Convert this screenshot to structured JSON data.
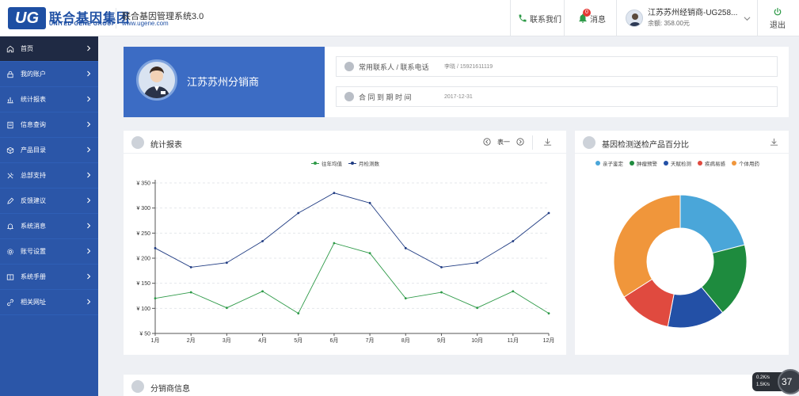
{
  "header": {
    "logo_mark": "UG",
    "logo_cn": "联合基因集团",
    "logo_en": "UNITED GENE GROUP",
    "system_title": "联合基因管理系统3.0",
    "system_url": "www.ugene.com",
    "contact_label": "联系我们",
    "messages_label": "消息",
    "messages_count": "0",
    "user_name": "江苏苏州经销商-UG258...",
    "user_balance": "余额: 358.00元",
    "logout_label": "退出",
    "accent_color": "#1e4fa3"
  },
  "sidebar": {
    "items": [
      {
        "label": "首页",
        "icon": "home-icon",
        "active": true
      },
      {
        "label": "我的账户",
        "icon": "lock-icon"
      },
      {
        "label": "统计报表",
        "icon": "bar-chart-icon"
      },
      {
        "label": "信息查询",
        "icon": "document-icon"
      },
      {
        "label": "产品目录",
        "icon": "box-icon"
      },
      {
        "label": "总部支持",
        "icon": "tools-icon"
      },
      {
        "label": "反馈建议",
        "icon": "edit-icon"
      },
      {
        "label": "系统消息",
        "icon": "bell-icon"
      },
      {
        "label": "账号设置",
        "icon": "gear-icon"
      },
      {
        "label": "系统手册",
        "icon": "book-icon"
      },
      {
        "label": "相关网址",
        "icon": "link-icon"
      }
    ],
    "bg_color": "#2b56a8"
  },
  "profile": {
    "name": "江苏苏州分销商",
    "contact_label": "常用联系人 / 联系电话",
    "contact_value": "李晓 / 15921611119",
    "contract_label": "合 同 到 期 时 间",
    "contract_value": "2017-12-31"
  },
  "stats_panel": {
    "title": "统计报表",
    "series_switch": "表一"
  },
  "pie_panel": {
    "title": "基因检测送检产品百分比"
  },
  "distributor_panel": {
    "title": "分销商信息"
  },
  "widget": {
    "line1": "0.2K/s",
    "line2": "1.5K/s",
    "percent": "37"
  },
  "chart_data": [
    {
      "type": "line",
      "x": [
        "1月",
        "2月",
        "3月",
        "4月",
        "5月",
        "6月",
        "7月",
        "8月",
        "9月",
        "10月",
        "11月",
        "12月"
      ],
      "series": [
        {
          "name": "往年均值",
          "color": "#2e9a48",
          "values": [
            120,
            132,
            101,
            134,
            90,
            230,
            210,
            120,
            132,
            101,
            134,
            90
          ]
        },
        {
          "name": "月检测数",
          "color": "#1f3b82",
          "values": [
            220,
            182,
            191,
            234,
            290,
            330,
            310,
            220,
            182,
            191,
            234,
            290
          ]
        }
      ],
      "y_ticks": [
        "¥ 50",
        "¥ 100",
        "¥ 150",
        "¥ 200",
        "¥ 250",
        "¥ 300",
        "¥ 350"
      ],
      "ylim": [
        50,
        350
      ],
      "grid": true,
      "legend": "top-center"
    },
    {
      "type": "pie",
      "donut": true,
      "labels": [
        "亲子鉴定",
        "肿瘤预警",
        "天赋检测",
        "疾病易感",
        "个体用药"
      ],
      "values": [
        21,
        18,
        14,
        13,
        34
      ],
      "colors": [
        "#4aa6d9",
        "#1e8b3e",
        "#2350a6",
        "#e04a3f",
        "#f0963b"
      ],
      "legend": "top-center"
    }
  ]
}
